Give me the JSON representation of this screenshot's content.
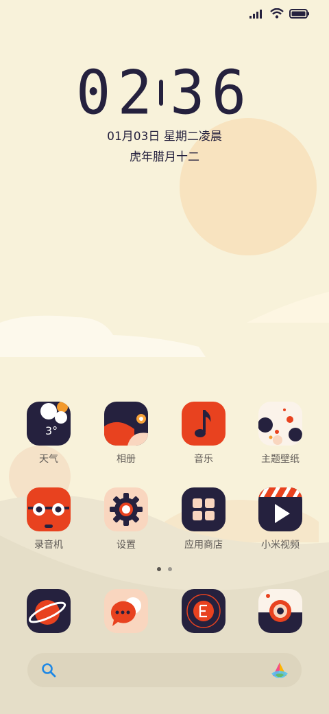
{
  "status": {
    "signal_icon": "signal-icon",
    "wifi_icon": "wifi-icon",
    "battery_icon": "battery-icon"
  },
  "lockscreen": {
    "hour": "02",
    "minute": "36",
    "date": "01月03日 星期二凌晨",
    "lunar": "虎年腊月十二"
  },
  "apps_row1": [
    {
      "label": "天气",
      "icon": "weather-icon",
      "temp": "3°"
    },
    {
      "label": "相册",
      "icon": "gallery-icon"
    },
    {
      "label": "音乐",
      "icon": "music-icon"
    },
    {
      "label": "主题壁纸",
      "icon": "themes-icon"
    }
  ],
  "apps_row2": [
    {
      "label": "录音机",
      "icon": "recorder-icon"
    },
    {
      "label": "设置",
      "icon": "settings-icon"
    },
    {
      "label": "应用商店",
      "icon": "app-store-icon"
    },
    {
      "label": "小米视频",
      "icon": "video-icon"
    }
  ],
  "dock": [
    {
      "icon": "phone-icon"
    },
    {
      "icon": "messages-icon"
    },
    {
      "icon": "browser-icon"
    },
    {
      "icon": "camera-icon"
    }
  ],
  "pages": {
    "count": 2,
    "active": 1
  },
  "search": {
    "icon": "search-icon",
    "assistant_icon": "assistant-icon"
  },
  "colors": {
    "background": "#f8f2da",
    "navy": "#25213e",
    "orange": "#e8421f",
    "peach": "#f9d6bf"
  }
}
